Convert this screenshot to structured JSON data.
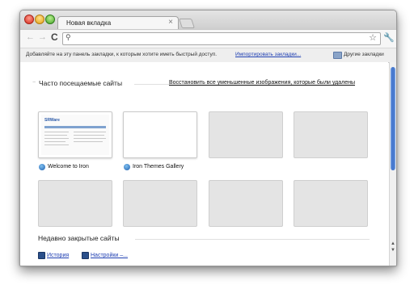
{
  "tab": {
    "title": "Новая вкладка",
    "close": "×"
  },
  "toolbar": {
    "back": "←",
    "forward": "→",
    "reload": "C",
    "search_glyph": "⚲",
    "star": "☆",
    "wrench": "🔧"
  },
  "bookmarks_bar": {
    "hint": "Добавляйте на эту панель закладки, к которым хотите иметь быстрый доступ.",
    "import_link": "Импортировать закладки...",
    "other": "Другие закладки"
  },
  "most_visited": {
    "minus": "−",
    "title": "Часто посещаемые сайты",
    "restore": "Восстановить все уменьшенные изображения, которые были удалены",
    "tiles": [
      {
        "label": "Welcome to Iron",
        "preview_logo": "SRWare"
      },
      {
        "label": "Iron Themes Gallery"
      }
    ]
  },
  "recently_closed": {
    "title": "Недавно закрытые сайты",
    "items": [
      {
        "label": "История"
      },
      {
        "label": "Настройки –..."
      }
    ]
  },
  "scrollbar": {
    "up": "▲",
    "down": "▼"
  }
}
